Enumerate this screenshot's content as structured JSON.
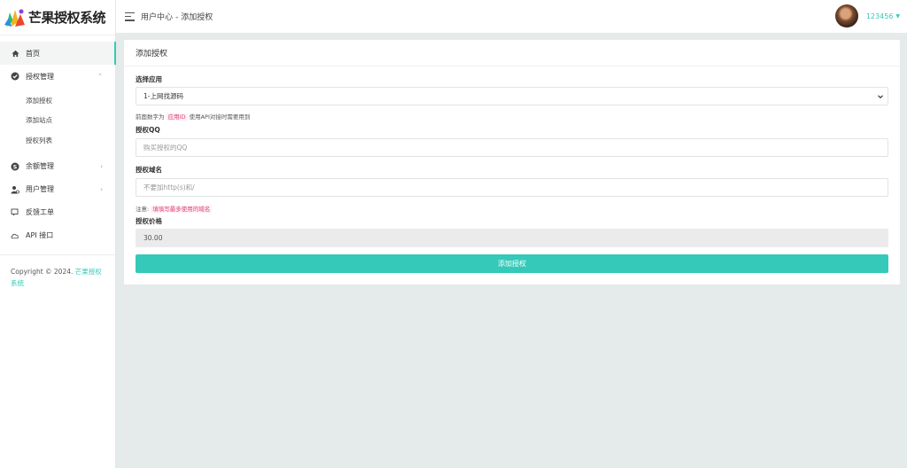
{
  "app": {
    "title": "芒果授权系统"
  },
  "sidebar": {
    "items": [
      {
        "label": "首页",
        "icon": "home-icon"
      },
      {
        "label": "授权管理",
        "icon": "check-circle-icon"
      },
      {
        "label": "余额管理",
        "icon": "skype-icon"
      },
      {
        "label": "用户管理",
        "icon": "user-gear-icon"
      },
      {
        "label": "反馈工单",
        "icon": "chat-icon"
      },
      {
        "label": "API 接口",
        "icon": "cloud-icon"
      }
    ],
    "sub_items": [
      "添加授权",
      "添加站点",
      "授权列表"
    ],
    "copyright_prefix": "Copyright © 2024.",
    "copyright_brand": "芒果授权系统"
  },
  "header": {
    "breadcrumb_section": "用户中心",
    "breadcrumb_separator": "-",
    "breadcrumb_page": "添加授权",
    "username": "123456"
  },
  "card": {
    "title": "添加授权",
    "app_select": {
      "label": "选择应用",
      "value": "1-上网找源码"
    },
    "app_hint": {
      "prefix": "前面数字为",
      "tag": "应用ID",
      "suffix": "使用API对接时需要用到"
    },
    "qq": {
      "label": "授权QQ",
      "placeholder": "购买授权的QQ"
    },
    "domain": {
      "label": "授权域名",
      "placeholder": "不要加http(s)和/"
    },
    "domain_hint": {
      "prefix": "注意:",
      "tag": "填填写最多使用的域名"
    },
    "price": {
      "label": "授权价格",
      "value": "30.00"
    },
    "submit_label": "添加授权"
  },
  "colors": {
    "accent": "#35c9b9",
    "hint_tag": "#e0457b",
    "background": "#e5eaea"
  }
}
